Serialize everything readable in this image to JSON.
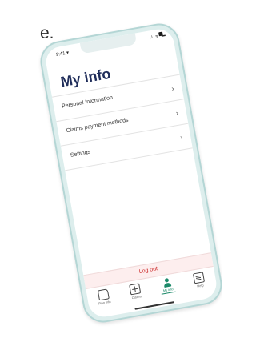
{
  "page": {
    "fragment_text": "e."
  },
  "status": {
    "time": "9:41 ▾",
    "right_icons": "·ıl ᯤ ▬"
  },
  "header": {
    "title": "My info"
  },
  "menu": {
    "items": [
      {
        "label": "Personal Information",
        "chevron": "›",
        "icon": "chevron-right-icon"
      },
      {
        "label": "Claims payment methods",
        "chevron": "›",
        "icon": "chevron-right-icon"
      },
      {
        "label": "Settings",
        "chevron": "›",
        "icon": "chevron-right-icon"
      }
    ]
  },
  "logout": {
    "label": "Log out"
  },
  "tabbar": {
    "tabs": [
      {
        "label": "Plan info",
        "icon": "document-icon",
        "active": false
      },
      {
        "label": "Claims",
        "icon": "plus-icon",
        "active": false
      },
      {
        "label": "My info",
        "icon": "person-icon",
        "active": true
      },
      {
        "label": "Help",
        "icon": "chat-icon",
        "active": false
      }
    ]
  },
  "colors": {
    "title": "#1f2d5a",
    "accent": "#1d8a6a",
    "logout_text": "#cc2b2b",
    "logout_bg": "#fdeeee",
    "phone_frame": "#ddeeed"
  }
}
